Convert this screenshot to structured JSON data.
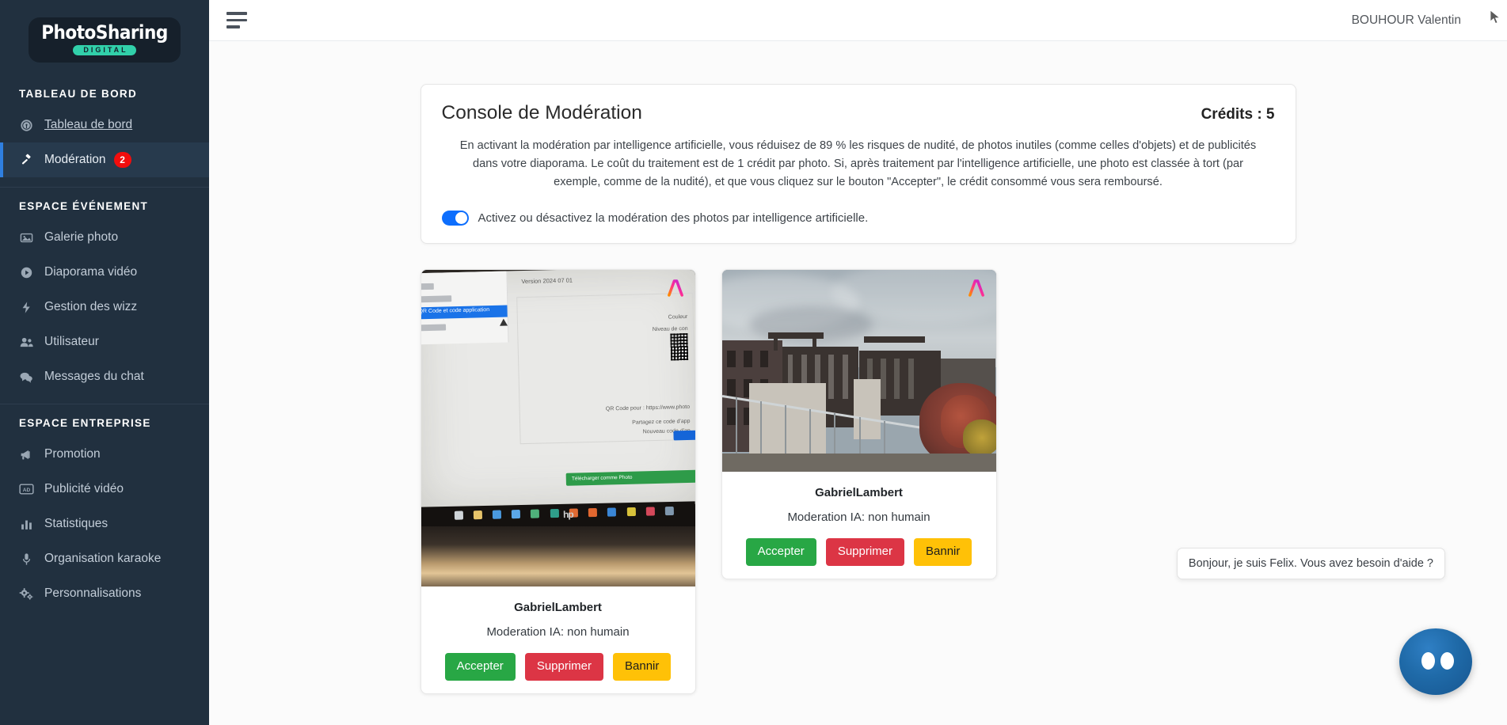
{
  "brand": {
    "name_part1": "Photo",
    "name_part2": "Sharing",
    "subtitle": "DIGITAL"
  },
  "sidebar": {
    "sections": [
      {
        "title": "TABLEAU DE BORD",
        "items": [
          {
            "label": "Tableau de bord",
            "icon": "dashboard-gauge-icon",
            "state": "hover",
            "badge": null
          },
          {
            "label": "Modération",
            "icon": "gavel-icon",
            "state": "active",
            "badge": "2"
          }
        ]
      },
      {
        "title": "ESPACE ÉVÉNEMENT",
        "items": [
          {
            "label": "Galerie photo",
            "icon": "image-icon",
            "state": "",
            "badge": null
          },
          {
            "label": "Diaporama vidéo",
            "icon": "play-circle-icon",
            "state": "",
            "badge": null
          },
          {
            "label": "Gestion des wizz",
            "icon": "bolt-icon",
            "state": "",
            "badge": null
          },
          {
            "label": "Utilisateur",
            "icon": "users-icon",
            "state": "",
            "badge": null
          },
          {
            "label": "Messages du chat",
            "icon": "chat-bubbles-icon",
            "state": "",
            "badge": null
          }
        ]
      },
      {
        "title": "ESPACE ENTREPRISE",
        "items": [
          {
            "label": "Promotion",
            "icon": "megaphone-icon",
            "state": "",
            "badge": null
          },
          {
            "label": "Publicité vidéo",
            "icon": "ad-icon",
            "state": "",
            "badge": null
          },
          {
            "label": "Statistiques",
            "icon": "bar-chart-icon",
            "state": "",
            "badge": null
          },
          {
            "label": "Organisation karaoke",
            "icon": "microphone-icon",
            "state": "",
            "badge": null
          },
          {
            "label": "Personnalisations",
            "icon": "gears-icon",
            "state": "",
            "badge": null
          }
        ]
      }
    ]
  },
  "topbar": {
    "menu_icon": "hamburger-menu-icon",
    "user_name": "BOUHOUR Valentin"
  },
  "panel": {
    "title": "Console de Modération",
    "credits": "Crédits : 5",
    "description": "En activant la modération par intelligence artificielle, vous réduisez de 89 % les risques de nudité, de photos inutiles (comme celles d'objets) et de publicités dans votre diaporama. Le coût du traitement est de 1 crédit par photo. Si, après traitement par l'intelligence artificielle, une photo est classée à tort (par exemple, comme de la nudité), et que vous cliquez sur le bouton \"Accepter\", le crédit consommé vous sera remboursé.",
    "toggle_label": "Activez ou désactivez la modération des photos par intelligence artificielle.",
    "toggle_state": "on"
  },
  "cards": [
    {
      "user": "GabrielLambert",
      "status": "Moderation IA: non humain",
      "ai_badge": "ai-gradient-icon",
      "photo_alt": "photo-monitor-screenshot",
      "buttons": {
        "accept": "Accepter",
        "delete": "Supprimer",
        "ban": "Bannir"
      }
    },
    {
      "user": "GabrielLambert",
      "status": "Moderation IA: non humain",
      "ai_badge": "ai-gradient-icon",
      "photo_alt": "photo-rooftop-buildings",
      "buttons": {
        "accept": "Accepter",
        "delete": "Supprimer",
        "ban": "Bannir"
      }
    }
  ],
  "chat": {
    "message": "Bonjour, je suis Felix. Vous avez besoin d'aide ?",
    "avatar": "felix-bot-avatar"
  },
  "colors": {
    "sidebar_bg": "#21303f",
    "sidebar_active": "#273a4d",
    "accent_blue": "#0d6efd",
    "badge_red": "#f20d0d",
    "accept_green": "#28a745",
    "delete_red": "#dc3545",
    "ban_yellow": "#ffc107",
    "brand_teal": "#31d0aa",
    "chat_blue": "#1f6aa8"
  }
}
